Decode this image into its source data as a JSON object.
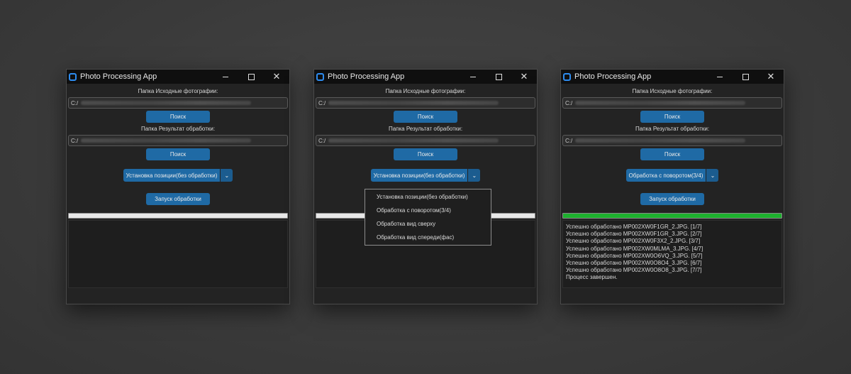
{
  "app": {
    "title": "Photo Processing App"
  },
  "labels": {
    "source_folder": "Папка Исходные фотографии:",
    "result_folder": "Папка Результат обработки:",
    "search_button": "Поиск",
    "start_button": "Запуск обработки"
  },
  "path_prefix": "C:/",
  "mode_options": [
    "Установка позиции(без обработки)",
    "Обработка с поворотом(3/4)",
    "Обработка вид сверху",
    "Обработка вид спереди(фас)"
  ],
  "windows": [
    {
      "selected_mode": "Установка позиции(без обработки)",
      "progress": 0,
      "dropdown_open": false,
      "log": []
    },
    {
      "selected_mode": "Установка позиции(без обработки)",
      "progress": 0,
      "dropdown_open": true,
      "log": []
    },
    {
      "selected_mode": "Обработка с поворотом(3/4)",
      "progress": 1.0,
      "dropdown_open": false,
      "log": [
        "Успешно обработано MP002XW0F1GR_2.JPG. [1/7]",
        "Успешно обработано MP002XW0F1GR_3.JPG. [2/7]",
        "Успешно обработано MP002XW0F3X2_2.JPG. [3/7]",
        "Успешно обработано MP002XW0MLMA_3.JPG. [4/7]",
        "Успешно обработано MP002XW0O6VQ_3.JPG. [5/7]",
        "Успешно обработано MP002XW0O8O4_3.JPG. [6/7]",
        "Успешно обработано MP002XW0O8O8_3.JPG. [7/7]",
        "Процесс завершен."
      ]
    }
  ],
  "colors": {
    "accent": "#1f6aa5",
    "progress_complete": "#1db02e",
    "app_icon": "#2d8cf0"
  }
}
